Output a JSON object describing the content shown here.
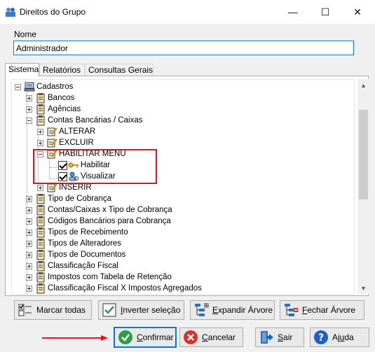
{
  "window": {
    "title": "Direitos do Grupo",
    "icon": "group-rights-app-icon",
    "minimize_glyph": "—",
    "maximize_glyph": "☐",
    "close_glyph": "✕"
  },
  "nome": {
    "label": "Nome",
    "value": "Administrador"
  },
  "tabs": [
    {
      "label": "Sistema",
      "active": true
    },
    {
      "label": "Relatórios",
      "active": false
    },
    {
      "label": "Consultas Gerais",
      "active": false
    }
  ],
  "tree": {
    "root": {
      "label": "Cadastros",
      "expanded": true,
      "icon": "computer-icon"
    },
    "items": [
      {
        "label": "Bancos",
        "expanded": false,
        "icon": "clipboard-icon"
      },
      {
        "label": "Agências",
        "expanded": false,
        "icon": "clipboard-icon"
      },
      {
        "label": "Contas Bancárias / Caixas",
        "expanded": true,
        "icon": "clipboard-icon"
      },
      {
        "label": "ALTERAR",
        "expanded": false,
        "icon": "edit-list-icon"
      },
      {
        "label": "EXCLUIR",
        "expanded": false,
        "icon": "edit-list-icon"
      },
      {
        "label": "HABILITAR MENU",
        "expanded": true,
        "icon": "edit-list-icon"
      },
      {
        "label": "Habilitar",
        "checked": true,
        "icon": "key-icon"
      },
      {
        "label": "Visualizar",
        "checked": true,
        "icon": "user-view-icon"
      },
      {
        "label": "INSERIR",
        "expanded": false,
        "icon": "edit-list-icon"
      },
      {
        "label": "Tipo de Cobrança",
        "expanded": false,
        "icon": "clipboard-icon"
      },
      {
        "label": "Contas/Caixas x Tipo de Cobrança",
        "expanded": false,
        "icon": "clipboard-icon"
      },
      {
        "label": "Códigos Bancários para Cobrança",
        "expanded": false,
        "icon": "clipboard-icon"
      },
      {
        "label": "Tipos de Recebimento",
        "expanded": false,
        "icon": "clipboard-icon"
      },
      {
        "label": "Tipos de Alteradores",
        "expanded": false,
        "icon": "clipboard-icon"
      },
      {
        "label": "Tipos de Documentos",
        "expanded": false,
        "icon": "clipboard-icon"
      },
      {
        "label": "Classificação Fiscal",
        "expanded": false,
        "icon": "clipboard-icon"
      },
      {
        "label": "Impostos com Tabela de Retenção",
        "expanded": false,
        "icon": "clipboard-icon"
      },
      {
        "label": "Classificação Fiscal X Impostos Agregados",
        "expanded": false,
        "icon": "clipboard-icon"
      }
    ],
    "highlight_color": "#e8111b"
  },
  "toolbar": {
    "marcar_todas": "Marcar todas",
    "inverter_selecao_pre": "I",
    "inverter_selecao_post": "nverter seleção",
    "expandir_arvore_pre": "E",
    "expandir_arvore_post": "xpandir Árvore",
    "fechar_arvore_pre": "F",
    "fechar_arvore_post": "echar Árvore"
  },
  "footer": {
    "confirmar_pre": "C",
    "confirmar_post": "onfirmar",
    "cancelar_pre": "C",
    "cancelar_post": "ancelar",
    "sair_pre": "S",
    "sair_post": "air",
    "ajuda_pre": "Aj",
    "ajuda_u": "u",
    "ajuda_post": "da"
  },
  "colors": {
    "accent": "#0078d7",
    "confirm_green": "#2e9e48",
    "cancel_red": "#d9322b",
    "help_blue": "#1e5fc2",
    "arrow_red": "#e8111b"
  }
}
